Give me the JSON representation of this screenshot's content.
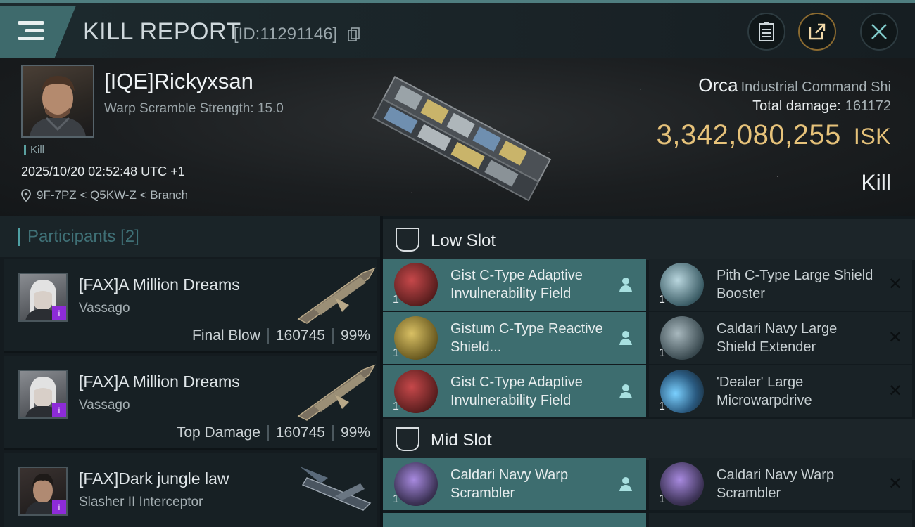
{
  "header": {
    "title": "KILL REPORT",
    "report_id": "[ID:11291146]",
    "menu_icon": "menu-icon",
    "buttons": [
      "clipboard-icon",
      "share-icon",
      "close-icon"
    ]
  },
  "victim": {
    "name": "[IQE]Rickyxsan",
    "warp_scramble": "Warp Scramble Strength: 15.0",
    "kill_tag": "Kill",
    "datetime": "2025/10/20 02:52:48 UTC +1",
    "location": "9F-7PZ < Q5KW-Z < Branch"
  },
  "ship": {
    "name": "Orca",
    "class": "Industrial Command Shi",
    "total_damage_label": "Total damage:",
    "total_damage": "161172",
    "isk_value": "3,342,080,255",
    "isk_unit": "ISK",
    "result": "Kill"
  },
  "participants": {
    "title": "Participants",
    "count": "[2]",
    "rows": [
      {
        "name": "[FAX]A Million Dreams",
        "ship": "Vassago",
        "role": "Final Blow",
        "damage": "160745",
        "percent": "99%",
        "badge": "i"
      },
      {
        "name": "[FAX]A Million Dreams",
        "ship": "Vassago",
        "role": "Top Damage",
        "damage": "160745",
        "percent": "99%",
        "badge": "i"
      },
      {
        "name": "[FAX]Dark jungle law",
        "ship": "Slasher II Interceptor",
        "role": "",
        "damage": "",
        "percent": "",
        "badge": "i"
      }
    ]
  },
  "fitting": {
    "low_slot_title": "Low Slot",
    "mid_slot_title": "Mid Slot",
    "low_slot": [
      {
        "name": "Gist C-Type Adaptive Invulnerability Field",
        "qty": "1",
        "status": "dropped-to-pod"
      },
      {
        "name": "Pith C-Type Large Shield Booster",
        "qty": "1",
        "status": "destroyed"
      },
      {
        "name": "Gistum C-Type Reactive Shield...",
        "qty": "1",
        "status": "dropped-to-pod"
      },
      {
        "name": "Caldari Navy Large Shield Extender",
        "qty": "1",
        "status": "destroyed"
      },
      {
        "name": "Gist C-Type Adaptive Invulnerability Field",
        "qty": "1",
        "status": "dropped-to-pod"
      },
      {
        "name": "'Dealer' Large Microwarpdrive",
        "qty": "1",
        "status": "destroyed"
      }
    ],
    "mid_slot": [
      {
        "name": "Caldari Navy Warp Scrambler",
        "qty": "1",
        "status": "dropped-to-pod"
      },
      {
        "name": "Caldari Navy Warp Scrambler",
        "qty": "1",
        "status": "destroyed"
      }
    ],
    "x_mark": "✕"
  },
  "colors": {
    "accent": "#4f7e80",
    "isk": "#e6c27a",
    "lost_row": "#3d6d6f",
    "badge": "#8d2bd8"
  }
}
